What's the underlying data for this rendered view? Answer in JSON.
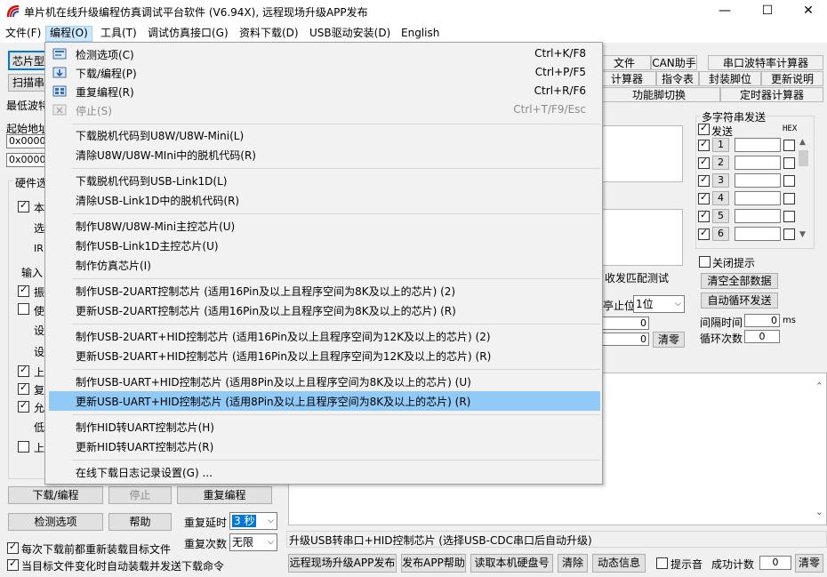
{
  "window": {
    "title": "单片机在线升级编程仿真调试平台软件 (V6.94X), 远程现场升级APP发布",
    "minimize": "—",
    "maximize": "☐",
    "close": "✕"
  },
  "menubar": [
    "文件(F)",
    "编程(O)",
    "工具(T)",
    "调试仿真接口(G)",
    "资料下载(D)",
    "USB驱动安装(D)",
    "English"
  ],
  "dropdown": {
    "items": [
      {
        "label": "检测选项(C)",
        "shortcut": "Ctrl+K/F8",
        "icon": "check-options-icon",
        "disabled": false
      },
      {
        "label": "下载/编程(P)",
        "shortcut": "Ctrl+P/F5",
        "icon": "download-icon",
        "disabled": false
      },
      {
        "label": "重复编程(R)",
        "shortcut": "Ctrl+R/F6",
        "icon": "repeat-program-icon",
        "disabled": false
      },
      {
        "label": "停止(S)",
        "shortcut": "Ctrl+T/F9/Esc",
        "icon": "stop-icon",
        "disabled": true
      },
      {
        "label": "下载脱机代码到U8W/U8W-Mini(L)",
        "shortcut": ""
      },
      {
        "label": "清除U8W/U8W-MIni中的脱机代码(R)",
        "shortcut": ""
      },
      {
        "label": "下载脱机代码到USB-Link1D(L)",
        "shortcut": ""
      },
      {
        "label": "清除USB-Link1D中的脱机代码(R)",
        "shortcut": ""
      },
      {
        "label": "制作U8W/U8W-Mini主控芯片(U)",
        "shortcut": ""
      },
      {
        "label": "制作USB-Link1D主控芯片(U)",
        "shortcut": ""
      },
      {
        "label": "制作仿真芯片(I)",
        "shortcut": ""
      },
      {
        "label": "制作USB-2UART控制芯片 (适用16Pin及以上且程序空间为8K及以上的芯片) (2)",
        "shortcut": ""
      },
      {
        "label": "更新USB-2UART控制芯片 (适用16Pin及以上且程序空间为8K及以上的芯片) (R)",
        "shortcut": ""
      },
      {
        "label": "制作USB-2UART+HID控制芯片 (适用16Pin及以上且程序空间为12K及以上的芯片) (2)",
        "shortcut": ""
      },
      {
        "label": "更新USB-2UART+HID控制芯片 (适用16Pin及以上且程序空间为12K及以上的芯片) (R)",
        "shortcut": ""
      },
      {
        "label": "制作USB-UART+HID控制芯片 (适用8Pin及以上且程序空间为8K及以上的芯片) (U)",
        "shortcut": ""
      },
      {
        "label": "更新USB-UART+HID控制芯片 (适用8Pin及以上且程序空间为8K及以上的芯片) (R)",
        "shortcut": ""
      },
      {
        "label": "制作HID转UART控制芯片(H)",
        "shortcut": ""
      },
      {
        "label": "更新HID转UART控制芯片(R)",
        "shortcut": ""
      },
      {
        "label": "在线下载日志记录设置(G) ...",
        "shortcut": ""
      }
    ]
  },
  "left": {
    "chip_type_btn": "芯片型",
    "scan_btn": "扫描串",
    "min_baud": "最低波特",
    "start_addr": "起始地址",
    "addr1": "0x0000",
    "addr2": "0x0000",
    "hw_group": "硬件选",
    "hw_rows": [
      "本",
      "选",
      "IR",
      "输入",
      "振",
      "使",
      "设",
      "设",
      "上",
      "复",
      "允",
      "低",
      "上"
    ],
    "download_btn": "下载/编程",
    "stop_btn": "停止",
    "repeat_btn": "重复编程",
    "check_btn": "检测选项",
    "help_btn": "帮助",
    "repeat_delay_label": "重复延时",
    "repeat_delay_value": "3 秒",
    "repeat_count_label": "重复次数",
    "repeat_count_value": "无限",
    "reload_each": "每次下载前都重新装载目标文件",
    "auto_send": "当目标文件变化时自动装载并发送下载命令"
  },
  "tabs": {
    "row1": [
      "文件",
      "CAN助手",
      "串口波特率计算器"
    ],
    "row2": [
      "计算器",
      "指令表",
      "封装脚位",
      "更新说明"
    ],
    "row3": [
      "功能脚切换",
      "定时器计算器"
    ]
  },
  "serial": {
    "match_test": "收发匹配测试",
    "stop_bits_label": "亭止位",
    "stop_bits_value": "1位",
    "count1": "0",
    "count2": "0",
    "clear_btn": "清零"
  },
  "multi": {
    "title": "多字符串发送",
    "send_label": "发送",
    "hex_label": "HEX",
    "rows": [
      "1",
      "2",
      "3",
      "4",
      "5",
      "6"
    ],
    "close_tip": "关闭提示",
    "clear_all_btn": "清空全部数据",
    "auto_loop_btn": "自动循环发送",
    "interval_label": "间隔时间",
    "interval_value": "0",
    "interval_unit": "ms",
    "loop_count_label": "循环次数",
    "loop_count_value": "0"
  },
  "status_line": "升级USB转串口+HID控制芯片 (选择USB-CDC串口后自动升级)",
  "bottom": {
    "remote_btn": "远程现场升级APP发布",
    "publish_help_btn": "发布APP帮助",
    "read_disk_btn": "读取本机硬盘号",
    "clear_btn": "清除",
    "dynamic_btn": "动态信息",
    "beep_label": "提示音",
    "success_label": "成功计数",
    "success_value": "0",
    "reset_btn": "清零"
  }
}
